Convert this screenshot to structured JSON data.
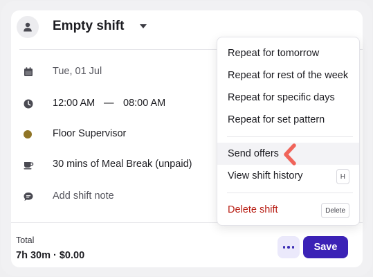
{
  "shift": {
    "title": "Empty shift",
    "date": "Tue, 01 Jul",
    "start_time": "12:00 AM",
    "dash": "—",
    "end_time": "08:00 AM",
    "role": "Floor Supervisor",
    "role_color": "#8f7426",
    "break": "30 mins of Meal Break (unpaid)",
    "note_placeholder": "Add shift note"
  },
  "footer": {
    "total_label": "Total",
    "total_value": "7h 30m · $0.00",
    "save_label": "Save"
  },
  "menu": {
    "repeat_tomorrow": "Repeat for tomorrow",
    "repeat_rest_week": "Repeat for rest of the week",
    "repeat_specific_days": "Repeat for specific days",
    "repeat_set_pattern": "Repeat for set pattern",
    "send_offers": "Send offers",
    "view_history": "View shift history",
    "view_history_shortcut": "H",
    "delete_shift": "Delete shift",
    "delete_shortcut": "Delete"
  },
  "icons": {
    "avatar": "user-icon",
    "date": "calendar-icon",
    "time": "clock-icon",
    "break": "coffee-cup-icon",
    "note": "speech-bubble-icon",
    "more": "more-horizontal-icon",
    "pointer": "chevron-left-arrow-icon"
  },
  "colors": {
    "accent": "#3b22b6",
    "danger": "#b81e14",
    "pointer": "#f0645a"
  }
}
